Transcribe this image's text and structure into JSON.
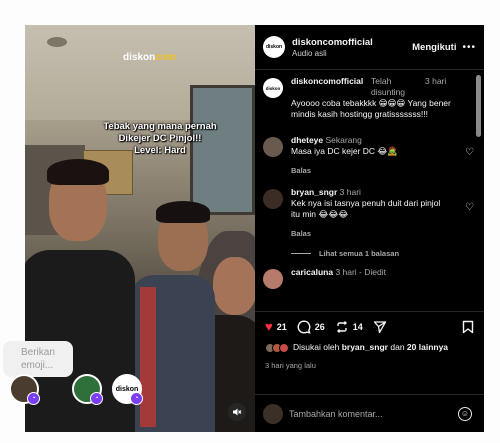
{
  "video": {
    "logo": "diskon",
    "logo_suffix": "com",
    "caption_lines": [
      "Tebak yang mana pernah",
      "Dikejer DC Pinjol!!",
      "Level: Hard"
    ],
    "mute_icon": "speaker-muted-icon"
  },
  "emoji_chip": {
    "label": "Berikan emoji..."
  },
  "bubbles": {
    "logo": "diskon",
    "badge_icon": "reaction-icon"
  },
  "header": {
    "username": "diskoncomofficial",
    "audio": "Audio asli",
    "follow": "Mengikuti",
    "more": "•••"
  },
  "comments": [
    {
      "username": "diskoncomofficial",
      "meta": "Telah disunting",
      "time": "3 hari",
      "text": "Ayoooo coba tebakkkk 😁😁😁 Yang bener mindis kasih hostingg gratisssssss!!!"
    },
    {
      "username": "dheteye",
      "time": "Sekarang",
      "text": "Masa iya DC kejer DC 😂🧟",
      "reply": "Balas"
    },
    {
      "username": "bryan_sngr",
      "time": "3 hari",
      "text": "Kek nya isi tasnya penuh duit dari pinjol itu min 😂😂😂",
      "reply": "Balas"
    },
    {
      "username": "caricaluna",
      "time": "3 hari",
      "edited": "Diedit"
    }
  ],
  "view_replies": "Lihat semua 1 balasan",
  "actions": {
    "likes": "21",
    "comments": "26",
    "reposts": "14"
  },
  "liked_by": {
    "prefix": "Disukai oleh",
    "user": "bryan_sngr",
    "and": "dan",
    "others": "20 lainnya"
  },
  "posted_ago": "3 hari yang lalu",
  "add_comment": {
    "placeholder": "Tambahkan komentar..."
  },
  "colors": {
    "like": "#ff3040",
    "accent_badge": "#7a3ff5",
    "brand_yellow": "#f2c21b"
  }
}
